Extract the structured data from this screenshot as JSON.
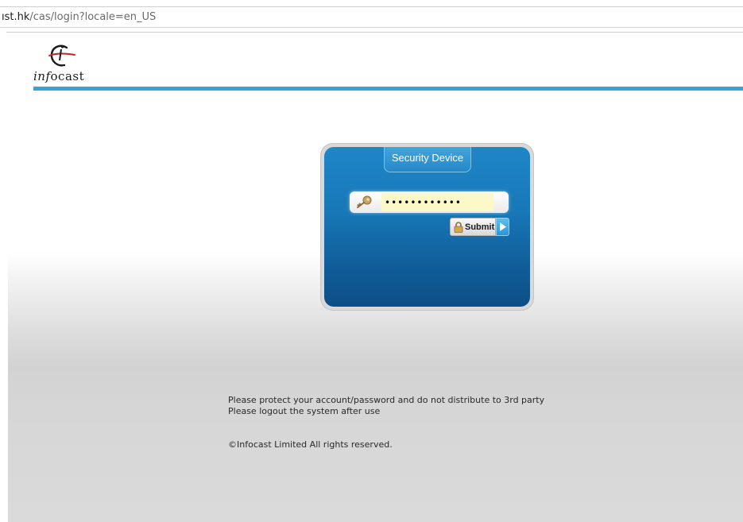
{
  "address_bar": {
    "host_fragment": "ıst.hk",
    "path": "/cas/login?locale=en_US"
  },
  "logo": {
    "text_italic": "inf",
    "text_rest": "ocast",
    "icon": "infocast-logo-icon"
  },
  "colors": {
    "header_line": "#3aa2d6",
    "panel_blue": "#1878b8",
    "password_bg": "#fcf8c8"
  },
  "login": {
    "tab_label": "Security Device",
    "key_icon": "key-icon",
    "password_value": "••••••••••••",
    "submit_label": "Submit",
    "lock_icon": "lock-icon",
    "arrow_icon": "play-arrow-icon"
  },
  "notice": {
    "line1": "Please protect your account/password and do not distribute to 3rd party",
    "line2": "Please logout the system after use"
  },
  "copyright": "©Infocast Limited All rights reserved."
}
